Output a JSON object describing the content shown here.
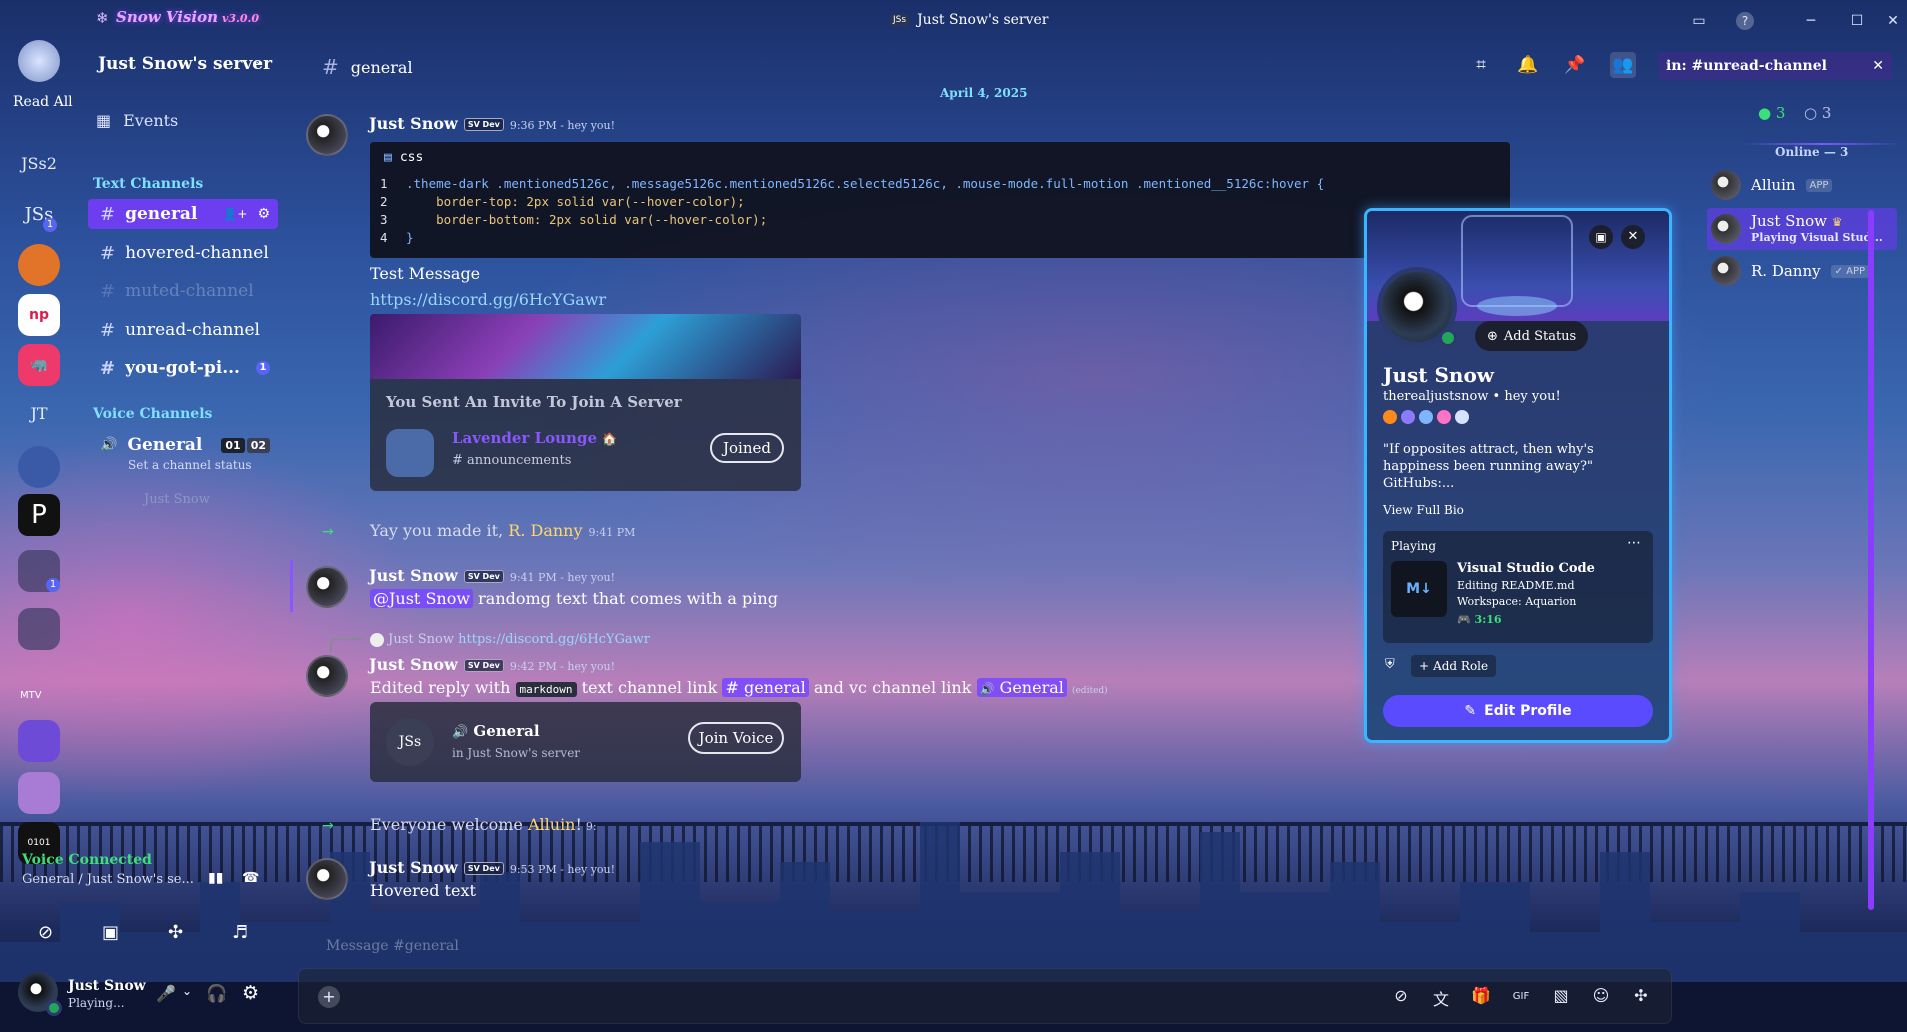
{
  "app": {
    "logo_text": "Snow Vision",
    "version": "v3.0.0",
    "window_title": "Just Snow's server",
    "window_badge": "JSs"
  },
  "guilds": {
    "read_all": "Read All",
    "labels": [
      "JSs2",
      "JSs",
      "JT",
      "MTV"
    ],
    "badge_js": "1",
    "badge_group": "1"
  },
  "sidebar": {
    "server_name": "Just Snow's server",
    "events": "Events",
    "text_category": "Text Channels",
    "voice_category": "Voice Channels",
    "channels": [
      {
        "name": "general"
      },
      {
        "name": "hovered-channel"
      },
      {
        "name": "muted-channel"
      },
      {
        "name": "unread-channel"
      },
      {
        "name": "you-got-pi...",
        "badge": "1"
      }
    ],
    "voice_channel": {
      "name": "General",
      "count_a": "01",
      "count_b": "02",
      "status": "Set a channel status",
      "member": "Just Snow"
    },
    "voice_connected": {
      "title": "Voice Connected",
      "location": "General / Just Snow's se..."
    },
    "user": {
      "name": "Just Snow",
      "status": "Playing..."
    }
  },
  "chat": {
    "channel": "general",
    "date_divider": "April 4, 2025",
    "code": {
      "lang": "css",
      "lines": [
        {
          "n": "1",
          "text": ".theme-dark .mentioned5126c, .message5126c.mentioned5126c.selected5126c, .mouse-mode.full-motion .mentioned__5126c:hover {"
        },
        {
          "n": "2",
          "text": "    border-top: 2px solid var(--hover-color);"
        },
        {
          "n": "3",
          "text": "    border-bottom: 2px solid var(--hover-color);"
        },
        {
          "n": "4",
          "text": "}"
        }
      ]
    },
    "msg1": {
      "author": "Just Snow",
      "tag": "SV Dev",
      "meta": "9:36 PM - hey you!",
      "text": "Test Message",
      "link": "https://discord.gg/6HcYGawr"
    },
    "invite": {
      "title": "You Sent An Invite To Join A Server",
      "server": "Lavender Lounge",
      "channel": "announcements",
      "button": "Joined"
    },
    "system1": {
      "text": "Yay you made it, ",
      "user": "R. Danny",
      "time": "9:41 PM"
    },
    "msg2": {
      "author": "Just Snow",
      "tag": "SV Dev",
      "meta": "9:41 PM - hey you!",
      "mention": "@Just Snow",
      "text": "randomg text that comes with a ping"
    },
    "msg3": {
      "reply_author": "Just Snow",
      "reply_link": "https://discord.gg/6HcYGawr",
      "author": "Just Snow",
      "tag": "SV Dev",
      "meta": "9:42 PM - hey you!",
      "text_a": "Edited reply with",
      "code": "markdown",
      "text_b": "text channel link",
      "chan_link": "# general",
      "text_c": "and vc channel link",
      "vc_link": "General",
      "edited": "(edited)"
    },
    "voice_embed": {
      "icon_text": "JSs",
      "name": "General",
      "sub": "in Just Snow's server",
      "button": "Join Voice"
    },
    "system2": {
      "text": "Everyone welcome ",
      "user": "Alluin",
      "time": "9:"
    },
    "msg4": {
      "author": "Just Snow",
      "tag": "SV Dev",
      "meta": "9:53 PM - hey you!",
      "text": "Hovered text"
    },
    "composer_placeholder": "Message #general"
  },
  "header": {
    "search_value": "in: #unread-channel",
    "online_count": "3",
    "offline_count": "3"
  },
  "members": {
    "section": "Online — 3",
    "list": [
      {
        "name": "Alluin",
        "tag": "APP"
      },
      {
        "name": "Just Snow",
        "activity": "Playing Visual Stud..."
      },
      {
        "name": "R. Danny",
        "tag": "✓ APP"
      }
    ]
  },
  "profile": {
    "add_status": "Add Status",
    "name": "Just Snow",
    "username": "therealjustsnow",
    "pronoun_status": "hey you!",
    "bio": "\"If opposites attract, then why's happiness been running away?\" GitHubs:...",
    "view_bio": "View Full Bio",
    "activity": {
      "label": "Playing",
      "title": "Visual Studio Code",
      "details": "Editing README.md",
      "state": "Workspace: Aquarion",
      "elapsed": "3:16"
    },
    "add_role": "Add Role",
    "edit_button": "Edit Profile"
  },
  "colors": {
    "accent": "#5b4bff",
    "mention": "#7846ff",
    "online": "#23a55a",
    "cyan": "#3ab6ff"
  }
}
